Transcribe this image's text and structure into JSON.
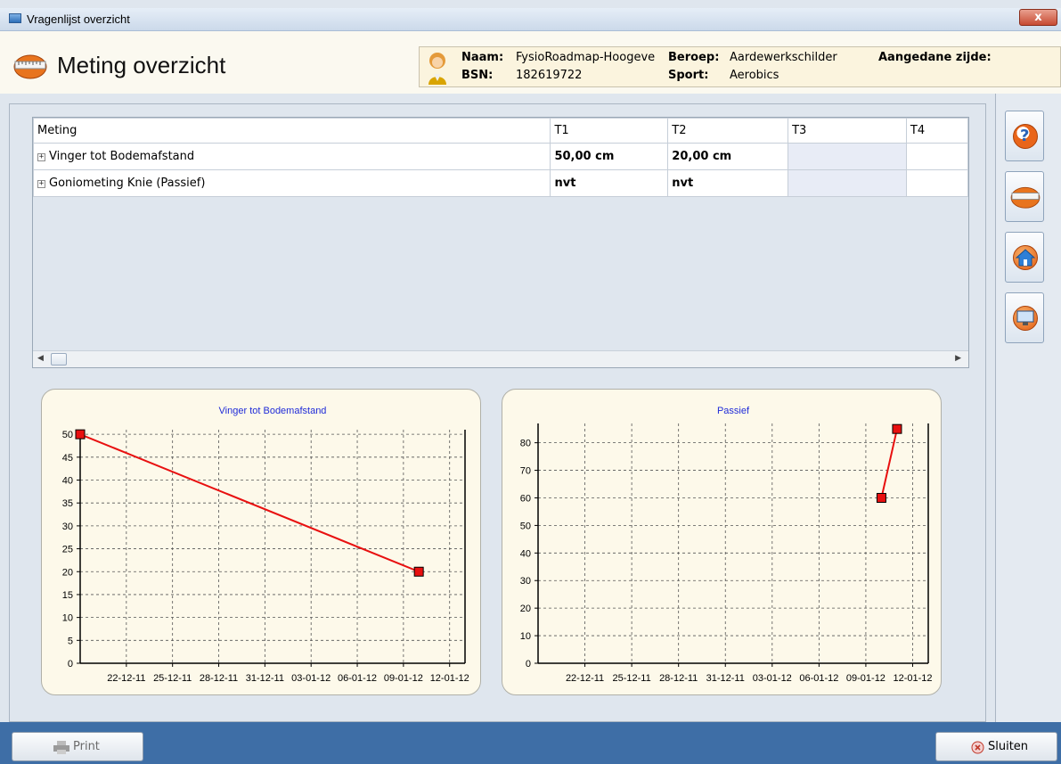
{
  "window": {
    "title": "Vragenlijst overzicht",
    "close_label": "x"
  },
  "page": {
    "title": "Meting overzicht"
  },
  "patient": {
    "naam_label": "Naam:",
    "naam_value": "FysioRoadmap-Hoogeve",
    "bsn_label": "BSN:",
    "bsn_value": "182619722",
    "beroep_label": "Beroep:",
    "beroep_value": "Aardewerkschilder",
    "sport_label": "Sport:",
    "sport_value": "Aerobics",
    "zijde_label": "Aangedane zijde:"
  },
  "grid": {
    "columns": [
      "Meting",
      "T1",
      "T2",
      "T3",
      "T4"
    ],
    "rows": [
      {
        "expander": "+",
        "label": "Vinger tot Bodemafstand",
        "t1": "50,00 cm",
        "t2": "20,00 cm",
        "t3": "",
        "t4": ""
      },
      {
        "expander": "+",
        "label": "Goniometing Knie (Passief)",
        "t1": "nvt",
        "t2": "nvt",
        "t3": "",
        "t4": ""
      }
    ]
  },
  "side_buttons": [
    {
      "icon": "help-icon"
    },
    {
      "icon": "measure-icon"
    },
    {
      "icon": "home-icon"
    },
    {
      "icon": "monitor-icon"
    }
  ],
  "buttons": {
    "print_label": "Print",
    "close_label": "Sluiten"
  },
  "chart_data": [
    {
      "type": "line",
      "title": "Vinger tot Bodemafstand",
      "xlabel": "",
      "ylabel": "",
      "x_ticks": [
        "22-12-11",
        "25-12-11",
        "28-12-11",
        "31-12-11",
        "03-01-12",
        "06-01-12",
        "09-01-12",
        "12-01-12"
      ],
      "y_ticks": [
        0,
        5,
        10,
        15,
        20,
        25,
        30,
        35,
        40,
        45,
        50
      ],
      "ylim": [
        0,
        51
      ],
      "xlim": [
        "2011-12-19",
        "2012-01-13"
      ],
      "grid": true,
      "series": [
        {
          "x": [
            "2011-12-19",
            "2012-01-10"
          ],
          "y": [
            50,
            20
          ],
          "color": "#e81010"
        }
      ]
    },
    {
      "type": "line",
      "title": "Passief",
      "xlabel": "",
      "ylabel": "",
      "x_ticks": [
        "22-12-11",
        "25-12-11",
        "28-12-11",
        "31-12-11",
        "03-01-12",
        "06-01-12",
        "09-01-12",
        "12-01-12"
      ],
      "y_ticks": [
        0,
        10,
        20,
        30,
        40,
        50,
        60,
        70,
        80
      ],
      "ylim": [
        0,
        87
      ],
      "xlim": [
        "2011-12-19",
        "2012-01-13"
      ],
      "grid": true,
      "series": [
        {
          "x": [
            "2012-01-10",
            "2012-01-11"
          ],
          "y": [
            60,
            85
          ],
          "color": "#e81010"
        }
      ]
    }
  ]
}
